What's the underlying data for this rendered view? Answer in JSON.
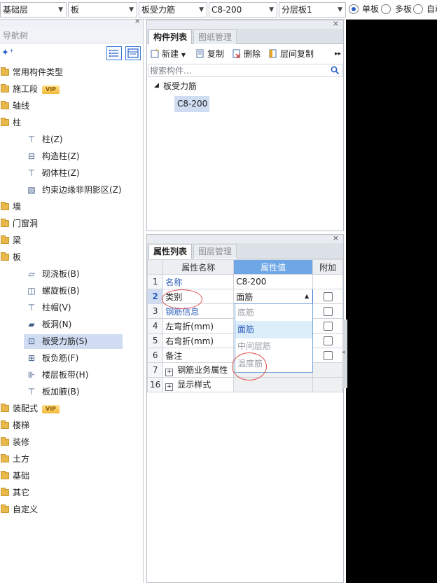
{
  "toolbar": {
    "floor": "基础层",
    "type": "板",
    "subtype": "板受力筋",
    "spec": "C8-200",
    "layer": "分层板1",
    "radio_single": "单板",
    "radio_multi": "多板",
    "radio_auto": "自动"
  },
  "nav": {
    "title": "导航树",
    "items": [
      {
        "label": "常用构件类型",
        "level": 0
      },
      {
        "label": "施工段",
        "level": 0,
        "badge": "VIP"
      },
      {
        "label": "轴线",
        "level": 0
      },
      {
        "label": "柱",
        "level": 0
      },
      {
        "label": "柱(Z)",
        "level": 1
      },
      {
        "label": "构造柱(Z)",
        "level": 1
      },
      {
        "label": "砌体柱(Z)",
        "level": 1
      },
      {
        "label": "约束边缘非阴影区(Z)",
        "level": 1
      },
      {
        "label": "墙",
        "level": 0
      },
      {
        "label": "门窗洞",
        "level": 0
      },
      {
        "label": "梁",
        "level": 0
      },
      {
        "label": "板",
        "level": 0
      },
      {
        "label": "现浇板(B)",
        "level": 1
      },
      {
        "label": "螺旋板(B)",
        "level": 1
      },
      {
        "label": "柱帽(V)",
        "level": 1
      },
      {
        "label": "板洞(N)",
        "level": 1
      },
      {
        "label": "板受力筋(S)",
        "level": 1,
        "selected": true
      },
      {
        "label": "板负筋(F)",
        "level": 1
      },
      {
        "label": "楼层板带(H)",
        "level": 1
      },
      {
        "label": "板加腋(B)",
        "level": 1
      },
      {
        "label": "装配式",
        "level": 0,
        "badge": "VIP"
      },
      {
        "label": "楼梯",
        "level": 0
      },
      {
        "label": "装修",
        "level": 0
      },
      {
        "label": "土方",
        "level": 0
      },
      {
        "label": "基础",
        "level": 0
      },
      {
        "label": "其它",
        "level": 0
      },
      {
        "label": "自定义",
        "level": 0
      }
    ]
  },
  "component_panel": {
    "tab_active": "构件列表",
    "tab_inactive": "图纸管理",
    "tools": {
      "new": "新建",
      "copy": "复制",
      "delete": "删除",
      "floor_copy": "层间复制"
    },
    "search_placeholder": "搜索构件...",
    "tree_root": "板受力筋",
    "tree_child": "C8-200"
  },
  "property_panel": {
    "tab_active": "属性列表",
    "tab_inactive": "图层管理",
    "headers": {
      "name": "属性名称",
      "value": "属性值",
      "extra": "附加"
    },
    "rows": [
      {
        "num": "1",
        "name": "名称",
        "value": "C8-200"
      },
      {
        "num": "2",
        "name": "类别",
        "value": "面筋"
      },
      {
        "num": "3",
        "name": "钢筋信息",
        "value": ""
      },
      {
        "num": "4",
        "name": "左弯折(mm)",
        "value": ""
      },
      {
        "num": "5",
        "name": "右弯折(mm)",
        "value": ""
      },
      {
        "num": "6",
        "name": "备注",
        "value": ""
      },
      {
        "num": "7",
        "name": "钢筋业务属性",
        "value": ""
      },
      {
        "num": "16",
        "name": "显示样式",
        "value": ""
      }
    ],
    "dropdown_options": [
      "底筋",
      "面筋",
      "中间层筋",
      "温度筋"
    ],
    "dropdown_selected": "面筋"
  },
  "colors": {
    "accent": "#6fa7e6",
    "selection": "#cfdcf2",
    "annotation": "#e05050"
  }
}
